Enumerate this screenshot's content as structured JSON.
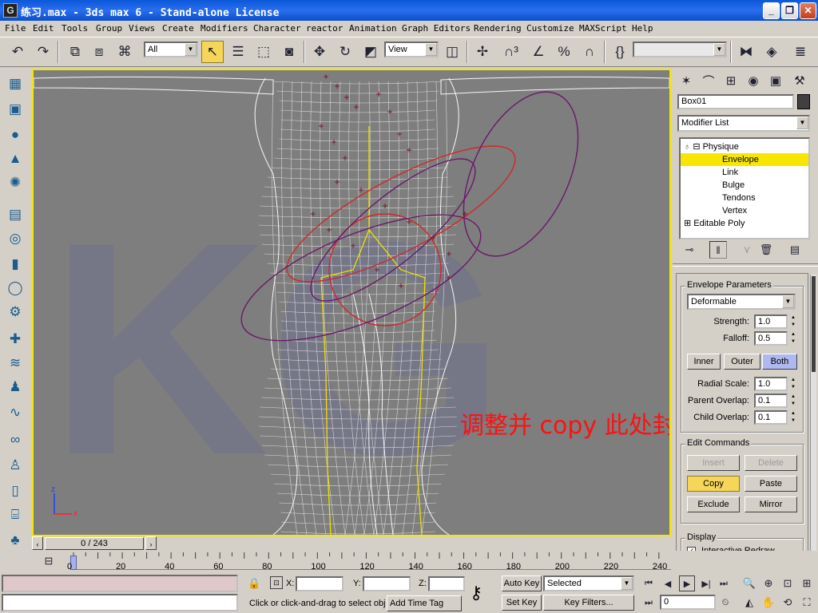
{
  "window": {
    "title": "练习.max - 3ds max 6 - Stand-alone License",
    "app_icon": "3ds-max-logo-icon",
    "minimize": "_",
    "restore": "❐",
    "close": "✕"
  },
  "menu": [
    "File",
    "Edit",
    "Tools",
    "Group",
    "Views",
    "Create",
    "Modifiers",
    "Character",
    "reactor",
    "Animation",
    "Graph Editors",
    "Rendering",
    "Customize",
    "MAXScript",
    "Help"
  ],
  "toolbar": {
    "selection_filter": "All",
    "reference_coord": "View",
    "named_selection": "",
    "icons": [
      "undo-icon",
      "redo-icon",
      "select-and-link-icon",
      "unlink-icon",
      "bind-to-spacewarp-icon",
      "select-object-icon",
      "select-by-name-icon",
      "rectangular-selection-icon",
      "window-crossing-icon",
      "select-and-move-icon",
      "select-and-rotate-icon",
      "select-and-scale-icon",
      "pivot-center-icon",
      "select-and-manipulate-icon",
      "snap-3d-icon",
      "angle-snap-icon",
      "percent-snap-icon",
      "spinner-snap-icon",
      "edit-named-selection-icon",
      "mirror-icon",
      "align-icon",
      "layer-manager-icon"
    ]
  },
  "left_tabs": [
    "create-objects-icon",
    "box-icon",
    "sphere-icon",
    "cone-icon",
    "geosphere-icon",
    "plane-icon",
    "torus-icon",
    "cylinder-icon",
    "tube-icon",
    "teapot-icon",
    "pyramid-icon",
    "gear-icon",
    "helper-icon",
    "spacewarp-icon",
    "wave-icon",
    "knot-icon",
    "character-icon",
    "door-icon",
    "stairs-icon",
    "tree-icon",
    "wall-icon"
  ],
  "viewport": {
    "annotation": "调整并 copy 此处封套",
    "axis_x": "x",
    "axis_z": "z",
    "watermark": "KG"
  },
  "command_panel": {
    "tab_icons": [
      "create-tab-icon",
      "modify-tab-icon",
      "hierarchy-tab-icon",
      "motion-tab-icon",
      "display-tab-icon",
      "utilities-tab-icon"
    ],
    "object_name": "Box01",
    "object_color": "#404040",
    "modifier_list": "Modifier List",
    "stack": [
      {
        "label": "Physique",
        "level": 0,
        "expanded": true
      },
      {
        "label": "Envelope",
        "level": 1,
        "selected": true
      },
      {
        "label": "Link",
        "level": 1
      },
      {
        "label": "Bulge",
        "level": 1
      },
      {
        "label": "Tendons",
        "level": 1
      },
      {
        "label": "Vertex",
        "level": 1
      },
      {
        "label": "Editable Poly",
        "level": 0,
        "expanded": false
      }
    ],
    "stack_icons": [
      "pin-stack-icon",
      "show-end-result-icon",
      "make-unique-icon",
      "remove-modifier-icon",
      "configure-modifier-sets-icon"
    ],
    "envelope": {
      "title": "Envelope Parameters",
      "type": "Deformable",
      "strength_label": "Strength:",
      "strength": "1.0",
      "falloff_label": "Falloff:",
      "falloff": "0.5",
      "inner": "Inner",
      "outer": "Outer",
      "both": "Both",
      "radial_scale_label": "Radial Scale:",
      "radial_scale": "1.0",
      "parent_overlap_label": "Parent Overlap:",
      "parent_overlap": "0.1",
      "child_overlap_label": "Child Overlap:",
      "child_overlap": "0.1"
    },
    "edit_commands": {
      "title": "Edit Commands",
      "insert": "Insert",
      "delete": "Delete",
      "copy": "Copy",
      "paste": "Paste",
      "exclude": "Exclude",
      "mirror": "Mirror"
    },
    "display": {
      "title": "Display",
      "interactive_redraw": "Interactive Redraw",
      "interactive_redraw_checked": true
    }
  },
  "timeline": {
    "frame": "0 / 243",
    "ticks": [
      "0",
      "20",
      "40",
      "60",
      "80",
      "100",
      "120",
      "140",
      "160",
      "180",
      "200",
      "220",
      "240"
    ]
  },
  "status": {
    "x_label": "X:",
    "y_label": "Y:",
    "z_label": "Z:",
    "x": "",
    "y": "",
    "z": "",
    "prompt": "Click or click-and-drag to select obj",
    "add_time_tag": "Add Time Tag",
    "auto_key": "Auto Key",
    "set_key": "Set Key",
    "key_mode": "Selected",
    "key_filters": "Key Filters...",
    "current_frame": "0"
  }
}
